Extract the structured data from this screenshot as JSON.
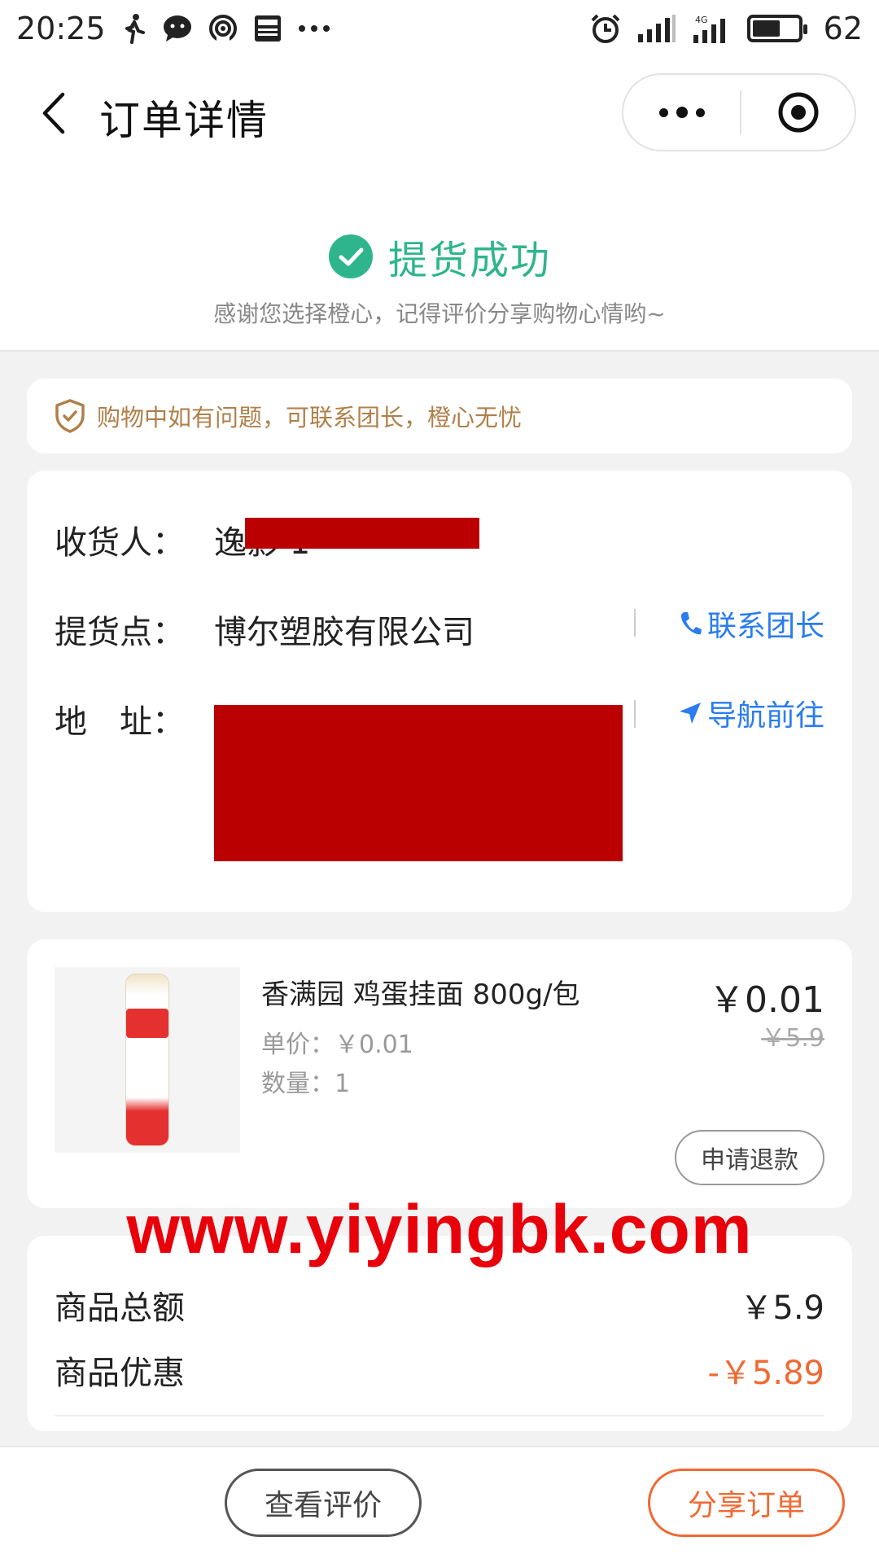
{
  "status_bar": {
    "time": "20:25",
    "network": "4G",
    "battery": "62",
    "battery_level": 0.62
  },
  "nav": {
    "title": "订单详情"
  },
  "status": {
    "title": "提货成功",
    "subtitle": "感谢您选择橙心，记得评价分享购物心情哟~"
  },
  "notice": {
    "text": "购物中如有问题，可联系团长，橙心无忧"
  },
  "order_info": {
    "receiver_label": "收货人：",
    "receiver_value": "逸影 1",
    "pickup_label": "提货点：",
    "pickup_value": "博尔塑胶有限公司",
    "contact_label": "联系团长",
    "address_label": "地　址：",
    "navigate_label": "导航前往"
  },
  "product": {
    "name": "香满园 鸡蛋挂面 800g/包",
    "unit_price": "单价：￥0.01",
    "quantity": "数量：1",
    "price": "￥0.01",
    "original_price": "￥5.9",
    "refund_label": "申请退款"
  },
  "summary": {
    "total_label": "商品总额",
    "total_value": "￥5.9",
    "discount_label": "商品优惠",
    "discount_value": "-￥5.89"
  },
  "watermark": "www.yiyingbk.com",
  "actions": {
    "review_label": "查看评价",
    "share_label": "分享订单"
  },
  "colors": {
    "success": "#2fb58e",
    "notice": "#b0804a",
    "link": "#2a7cf0",
    "discount": "#f06a33",
    "watermark": "#e8000b"
  }
}
